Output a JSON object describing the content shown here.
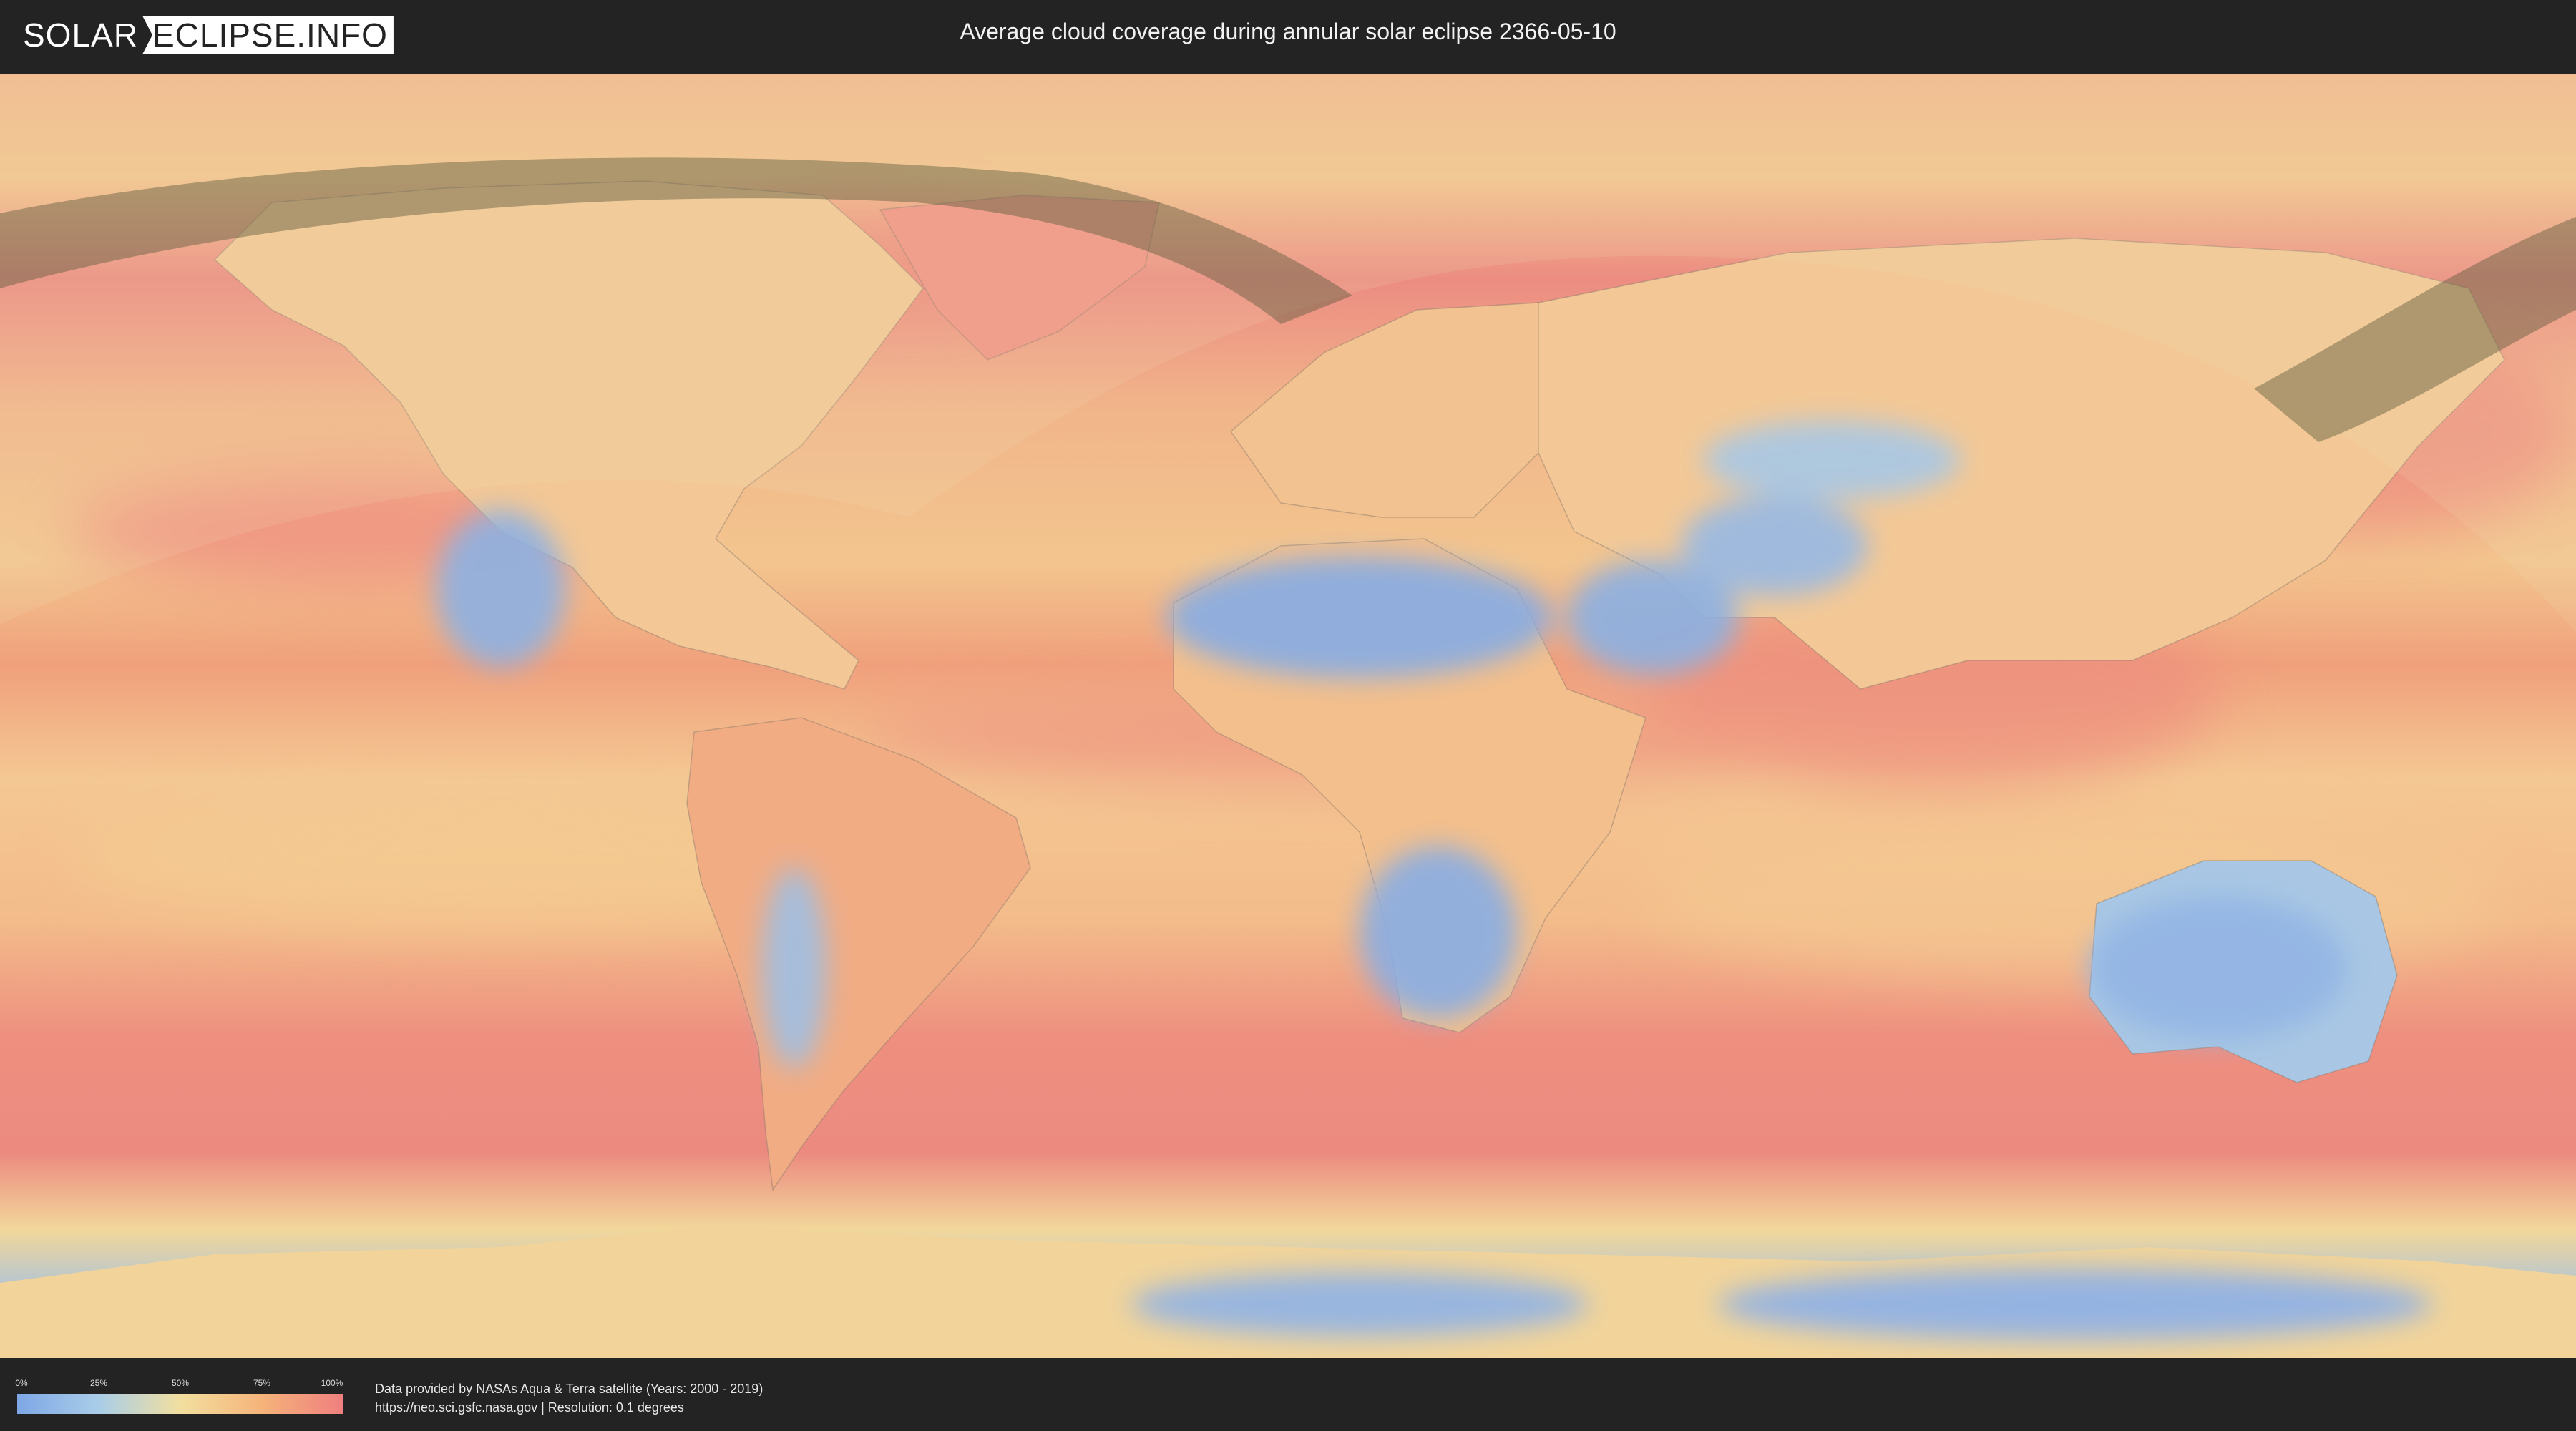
{
  "header": {
    "logo_left": "SOLAR",
    "logo_right": "ECLIPSE.INFO",
    "title": "Average cloud coverage during annular solar eclipse 2366-05-10"
  },
  "map": {
    "colors": {
      "clear": "#7ea7e6",
      "low": "#a9cde8",
      "mid": "#f2df9f",
      "high": "#f5b37a",
      "overcast": "#ef7f7f",
      "shadow_band": "#5e5a3e",
      "ocean_base": "#f3b989"
    }
  },
  "legend": {
    "ticks": [
      "0%",
      "25%",
      "50%",
      "75%",
      "100%"
    ]
  },
  "footer": {
    "credit_line1": "Data provided by NASAs Aqua & Terra satellite (Years: 2000 - 2019)",
    "credit_line2": "https://neo.sci.gsfc.nasa.gov | Resolution: 0.1 degrees"
  }
}
